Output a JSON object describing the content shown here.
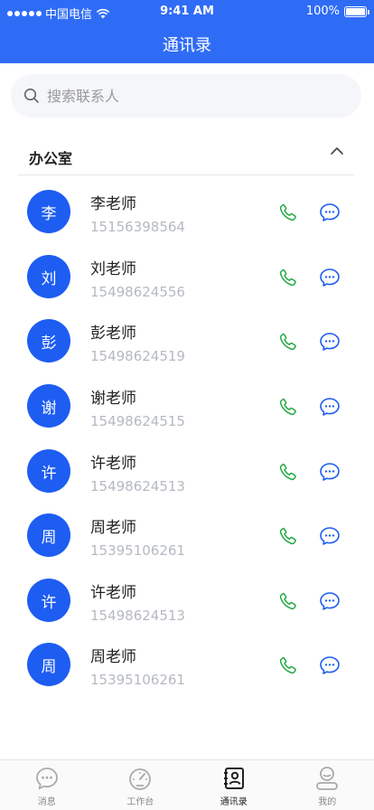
{
  "status_bar": {
    "carrier": "中国电信",
    "time": "9:41 AM",
    "battery": "100%"
  },
  "header": {
    "title": "通讯录"
  },
  "search": {
    "placeholder": "搜索联系人"
  },
  "section": {
    "name": "办公室",
    "expanded": true
  },
  "contacts": [
    {
      "initial": "李",
      "name": "李老师",
      "phone": "15156398564"
    },
    {
      "initial": "刘",
      "name": "刘老师",
      "phone": "15498624556"
    },
    {
      "initial": "彭",
      "name": "彭老师",
      "phone": "15498624519"
    },
    {
      "initial": "谢",
      "name": "谢老师",
      "phone": "15498624515"
    },
    {
      "initial": "许",
      "name": "许老师",
      "phone": "15498624513"
    },
    {
      "initial": "周",
      "name": "周老师",
      "phone": "15395106261"
    },
    {
      "initial": "许",
      "name": "许老师",
      "phone": "15498624513"
    },
    {
      "initial": "周",
      "name": "周老师",
      "phone": "15395106261"
    }
  ],
  "tabs": [
    {
      "label": "消息",
      "icon": "chat-bubble-icon",
      "active": false
    },
    {
      "label": "工作台",
      "icon": "speedometer-icon",
      "active": false
    },
    {
      "label": "通讯录",
      "icon": "contacts-book-icon",
      "active": true
    },
    {
      "label": "我的",
      "icon": "profile-icon",
      "active": false
    }
  ],
  "colors": {
    "header": "#2f6cf6",
    "avatar": "#1e5df2",
    "call_icon": "#22a745",
    "message_icon": "#1e5df2"
  }
}
